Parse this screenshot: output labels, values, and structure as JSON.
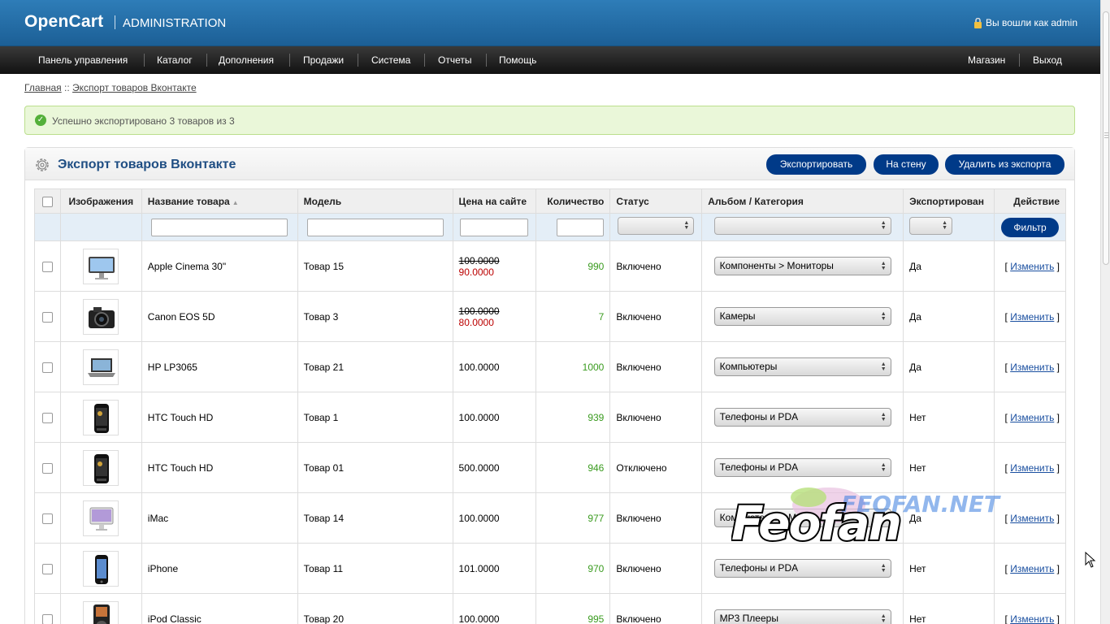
{
  "header": {
    "logo": "OpenCart",
    "logo_sub": "ADMINISTRATION",
    "logged_in": "Вы вошли как admin"
  },
  "menu": {
    "items": [
      "Панель управления",
      "Каталог",
      "Дополнения",
      "Продажи",
      "Система",
      "Отчеты",
      "Помощь"
    ],
    "store": "Магазин",
    "logout": "Выход"
  },
  "breadcrumb": {
    "home": "Главная",
    "separator": "::",
    "current": "Экспорт товаров Вконтакте"
  },
  "success": "Успешно экспортировано 3 товаров из 3",
  "box": {
    "title": "Экспорт товаров Вконтакте",
    "buttons": {
      "export": "Экспортировать",
      "wall": "На стену",
      "remove": "Удалить из экспорта"
    }
  },
  "table": {
    "columns": {
      "image": "Изображения",
      "name": "Название товара",
      "model": "Модель",
      "price": "Цена на сайте",
      "quantity": "Количество",
      "status": "Статус",
      "album": "Альбом / Категория",
      "exported": "Экспортирован",
      "action": "Действие"
    },
    "filter_button": "Фильтр",
    "edit_label": "Изменить",
    "rows": [
      {
        "name": "Apple Cinema 30\"",
        "model": "Товар 15",
        "price": "100.0000",
        "special": "90.0000",
        "quantity": "990",
        "status": "Включено",
        "album": "Компоненты > Мониторы",
        "exported": "Да",
        "icon": "monitor-image"
      },
      {
        "name": "Canon EOS 5D",
        "model": "Товар 3",
        "price": "100.0000",
        "special": "80.0000",
        "quantity": "7",
        "status": "Включено",
        "album": "Камеры",
        "exported": "Да",
        "icon": "camera-image"
      },
      {
        "name": "HP LP3065",
        "model": "Товар 21",
        "price": "100.0000",
        "special": "",
        "quantity": "1000",
        "status": "Включено",
        "album": "Компьютеры",
        "exported": "Да",
        "icon": "laptop-image"
      },
      {
        "name": "HTC Touch HD",
        "model": "Товар 1",
        "price": "100.0000",
        "special": "",
        "quantity": "939",
        "status": "Включено",
        "album": "Телефоны и PDA",
        "exported": "Нет",
        "icon": "phone-image"
      },
      {
        "name": "HTC Touch HD",
        "model": "Товар 01",
        "price": "500.0000",
        "special": "",
        "quantity": "946",
        "status": "Отключено",
        "album": "Телефоны и PDA",
        "exported": "Нет",
        "icon": "phone-image"
      },
      {
        "name": "iMac",
        "model": "Товар 14",
        "price": "100.0000",
        "special": "",
        "quantity": "977",
        "status": "Включено",
        "album": "Компьютеры > Mac",
        "exported": "Да",
        "icon": "imac-image"
      },
      {
        "name": "iPhone",
        "model": "Товар 11",
        "price": "101.0000",
        "special": "",
        "quantity": "970",
        "status": "Включено",
        "album": "Телефоны и PDA",
        "exported": "Нет",
        "icon": "iphone-image"
      },
      {
        "name": "iPod Classic",
        "model": "Товар 20",
        "price": "100.0000",
        "special": "",
        "quantity": "995",
        "status": "Включено",
        "album": "MP3 Плееры",
        "exported": "Нет",
        "icon": "ipod-image"
      }
    ]
  },
  "colors": {
    "header_blue": "#1c5f96",
    "button_blue": "#003a88",
    "title_blue": "#1f4e83",
    "qty_green": "#3a9b1f",
    "special_red": "#bb0000"
  }
}
